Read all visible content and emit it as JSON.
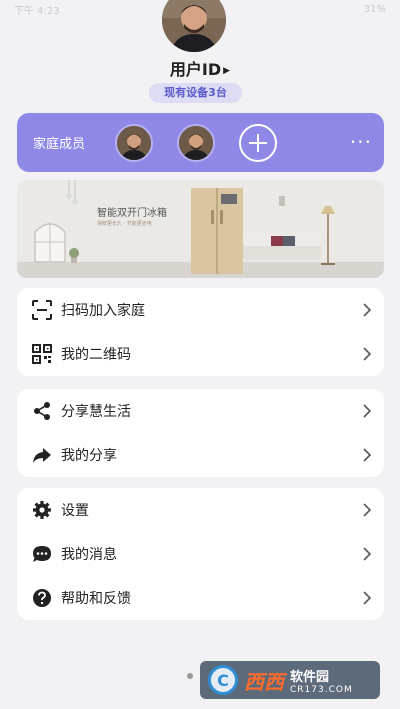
{
  "status_bar": {
    "left": "下午 4:23",
    "right": "31%"
  },
  "profile": {
    "user_id": "用户ID",
    "device_badge": "现有设备3台"
  },
  "family": {
    "label": "家庭成员",
    "more": "···"
  },
  "banner": {
    "title": "智能双开门冰箱",
    "subtitle": "保鲜更长久 · 节能更省电"
  },
  "group1": [
    {
      "label": "扫码加入家庭",
      "icon": "scan-icon"
    },
    {
      "label": "我的二维码",
      "icon": "qrcode-icon"
    }
  ],
  "group2": [
    {
      "label": "分享慧生活",
      "icon": "share-icon"
    },
    {
      "label": "我的分享",
      "icon": "forward-arrow-icon"
    }
  ],
  "group3": [
    {
      "label": "设置",
      "icon": "gear-icon"
    },
    {
      "label": "我的消息",
      "icon": "message-icon"
    },
    {
      "label": "帮助和反馈",
      "icon": "help-icon"
    }
  ],
  "watermark": {
    "brand": "西西",
    "title": "软件园",
    "url": "CR173.COM"
  },
  "colors": {
    "accent": "#8f88e6",
    "badge_bg": "#dcdcf4",
    "badge_text": "#5a5acb"
  }
}
